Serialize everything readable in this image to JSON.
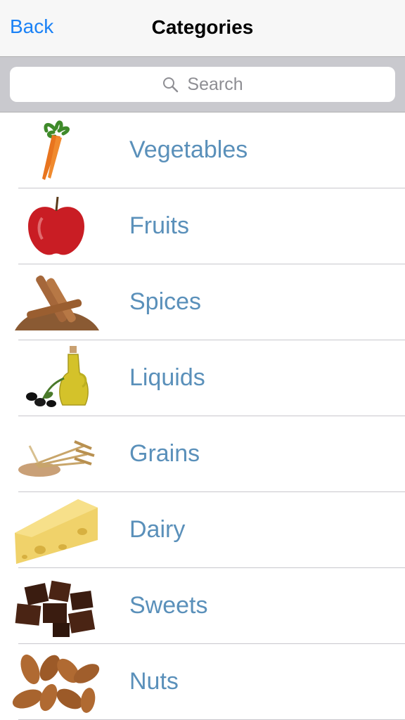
{
  "nav": {
    "back_label": "Back",
    "title": "Categories"
  },
  "search": {
    "placeholder": "Search"
  },
  "categories": [
    {
      "label": "Vegetables",
      "icon": "carrot-icon"
    },
    {
      "label": "Fruits",
      "icon": "apple-icon"
    },
    {
      "label": "Spices",
      "icon": "cinnamon-icon"
    },
    {
      "label": "Liquids",
      "icon": "olive-oil-icon"
    },
    {
      "label": "Grains",
      "icon": "wheat-icon"
    },
    {
      "label": "Dairy",
      "icon": "cheese-icon"
    },
    {
      "label": "Sweets",
      "icon": "chocolate-icon"
    },
    {
      "label": "Nuts",
      "icon": "almond-icon"
    }
  ],
  "colors": {
    "accent": "#1b82f6",
    "label": "#5a90ba",
    "separator": "#c8c7cc"
  }
}
